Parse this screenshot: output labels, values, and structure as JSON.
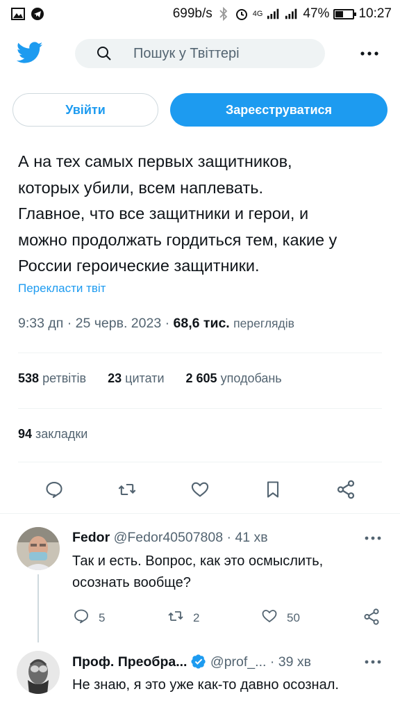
{
  "statusbar": {
    "speed": "699b/s",
    "network": "4G",
    "battery": "47%",
    "battery_level": 0.47,
    "time": "10:27"
  },
  "header": {
    "search_placeholder": "Пошук у Твіттері",
    "login_label": "Увійти",
    "signup_label": "Зареєструватися"
  },
  "tweet": {
    "text": "А на тех самых первых защитников,\nкоторых убили, всем наплевать.\nГлавное, что все защитники и герои, и\nможно продолжать гордиться тем, какие у\nРоссии героические защитники.",
    "translate_label": "Перекласти твіт",
    "time": "9:33 дп",
    "date": "25 черв. 2023",
    "views_count": "68,6 тис.",
    "views_label": "переглядів",
    "retweets_count": "538",
    "retweets_label": "ретвітів",
    "quotes_count": "23",
    "quotes_label": "цитати",
    "likes_count": "2 605",
    "likes_label": "уподобань",
    "bookmarks_count": "94",
    "bookmarks_label": "закладки"
  },
  "replies": [
    {
      "name": "Fedor",
      "handle": "@Fedor40507808",
      "time": "41 хв",
      "text": "Так и есть. Вопрос, как это осмыслить, осознать вообще?",
      "replies": "5",
      "retweets": "2",
      "likes": "50"
    },
    {
      "name": "Проф. Преобра...",
      "handle": "@prof_...",
      "time": "39 хв",
      "text": "Не знаю, я это уже как-то давно осознал."
    }
  ],
  "colors": {
    "accent": "#1d9bf0",
    "text": "#0f1419",
    "secondary": "#536471",
    "divider": "#eff3f4"
  }
}
